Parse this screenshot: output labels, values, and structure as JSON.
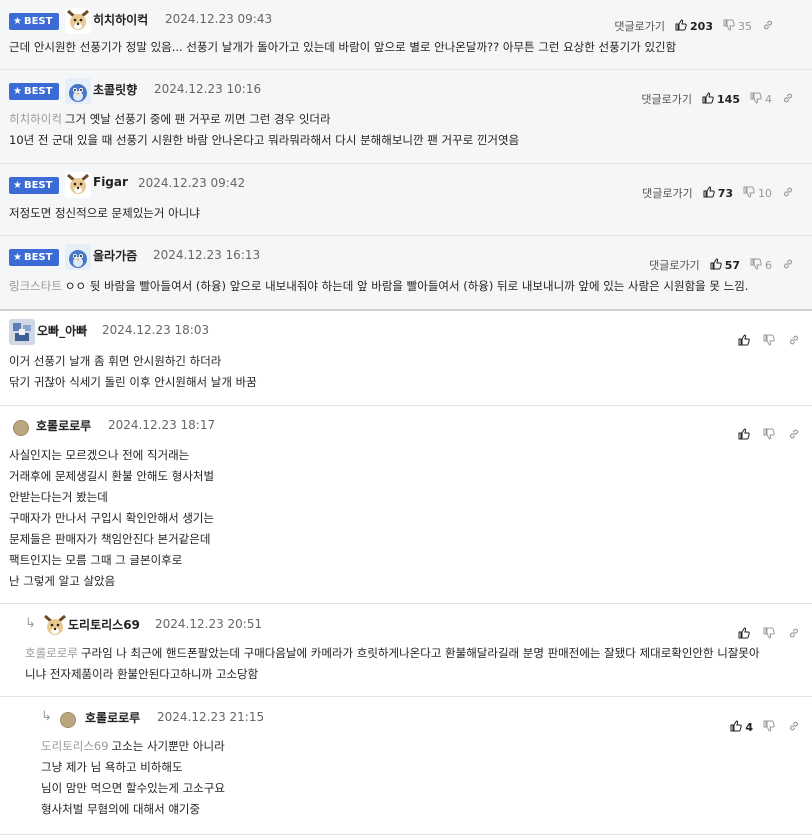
{
  "labels": {
    "best": "BEST",
    "reply_link": "댓글로가기"
  },
  "colors": {
    "accent": "#3d6bd6",
    "best_bg": "#f5f6f8",
    "muted": "#999999"
  },
  "comments": [
    {
      "best": true,
      "avatar": "dog-avatar",
      "author": "히치하이컥",
      "date": "2024.12.23 09:43",
      "up": "203",
      "down": "35",
      "lines": [
        "근데 안시원한 선풍기가 정말 있음... 선풍기 날개가 돌아가고 있는데 바람이 앞으로 별로 안나온달까?? 아무튼 그런 요상한 선풍기가 있긴함"
      ]
    },
    {
      "best": true,
      "avatar": "bird-avatar",
      "author": "초콜릿향",
      "date": "2024.12.23 10:16",
      "up": "145",
      "down": "4",
      "mention": "히치하이컥",
      "lines": [
        "그거 옛날 선풍기 중에 팬 거꾸로 끼면 그런 경우 잇더라",
        "10년 전 군대 있을 때 선풍기 시원한 바람 안나온다고 뭐라뭐라해서 다시 분해해보니깐 팬 거꾸로 낀거엿음"
      ]
    },
    {
      "best": true,
      "avatar": "dog-avatar",
      "author": "Figar",
      "date": "2024.12.23 09:42",
      "up": "73",
      "down": "10",
      "lines": [
        "저정도면 정신적으로 문제있는거 아니냐"
      ]
    },
    {
      "best": true,
      "avatar": "bird-avatar",
      "author": "올라가즘",
      "date": "2024.12.23 16:13",
      "up": "57",
      "down": "6",
      "mention": "링크스타트",
      "lines": [
        "ㅇㅇ 뒷 바람을 빨아들여서 (하융) 앞으로 내보내줘야 하는데 앞 바람을 빨아들여서 (하융) 뒤로 내보내니까 앞에 있는 사람은 시원함을 못 느낌."
      ]
    },
    {
      "best": false,
      "avatar": "pixel-avatar",
      "author": "오빠_아빠",
      "date": "2024.12.23 18:03",
      "up": "",
      "down": "",
      "lines": [
        "이거 선풍기 날개 좀 휘면 안시원하긴 하더라",
        "닦기 귀찮아 식세기 돌린 이후 안시원해서 날개 바꿈"
      ]
    },
    {
      "best": false,
      "avatar": "dot-avatar",
      "author": "호롤로로루",
      "date": "2024.12.23 18:17",
      "up": "",
      "down": "",
      "lines": [
        "사실인지는 모르겠으나 전에 직거래는",
        "거래후에 문제생길시 환불 안해도 형사처벌",
        "안받는다는거 봤는데",
        "구매자가 만나서 구입시 확인안해서 생기는",
        "문제들은 판매자가 책임안진다 본거같은데",
        "팩트인지는 모름 그때 그 글본이후로",
        "난 그렇게 알고 살았음"
      ]
    },
    {
      "best": false,
      "reply": true,
      "avatar": "dog-avatar",
      "author": "도리토리스69",
      "date": "2024.12.23 20:51",
      "up": "",
      "down": "",
      "mention": "호롤로로루",
      "lines": [
        "구라임 나 최근에 핸드폰팔았는데 구매다음날에 카메라가 흐릿하게나온다고 환불해달라길래 분명 판매전에는 잘됐다 제대로확인안한 니잘못아",
        "니냐 전자제품이라 환불안된다고하니까 고소당함"
      ]
    },
    {
      "best": false,
      "reply": true,
      "avatar": "dot-avatar",
      "author": "호롤로로루",
      "date": "2024.12.23 21:15",
      "up": "4",
      "down": "",
      "mention": "도리토리스69",
      "lines": [
        "고소는 사기뿐만 아니라",
        "그냥 제가 님 욕하고 비하해도",
        "님이 맘만 먹으면 할수있는게 고소구요",
        "형사처벌 무혐의에 대해서 얘기중"
      ]
    }
  ]
}
